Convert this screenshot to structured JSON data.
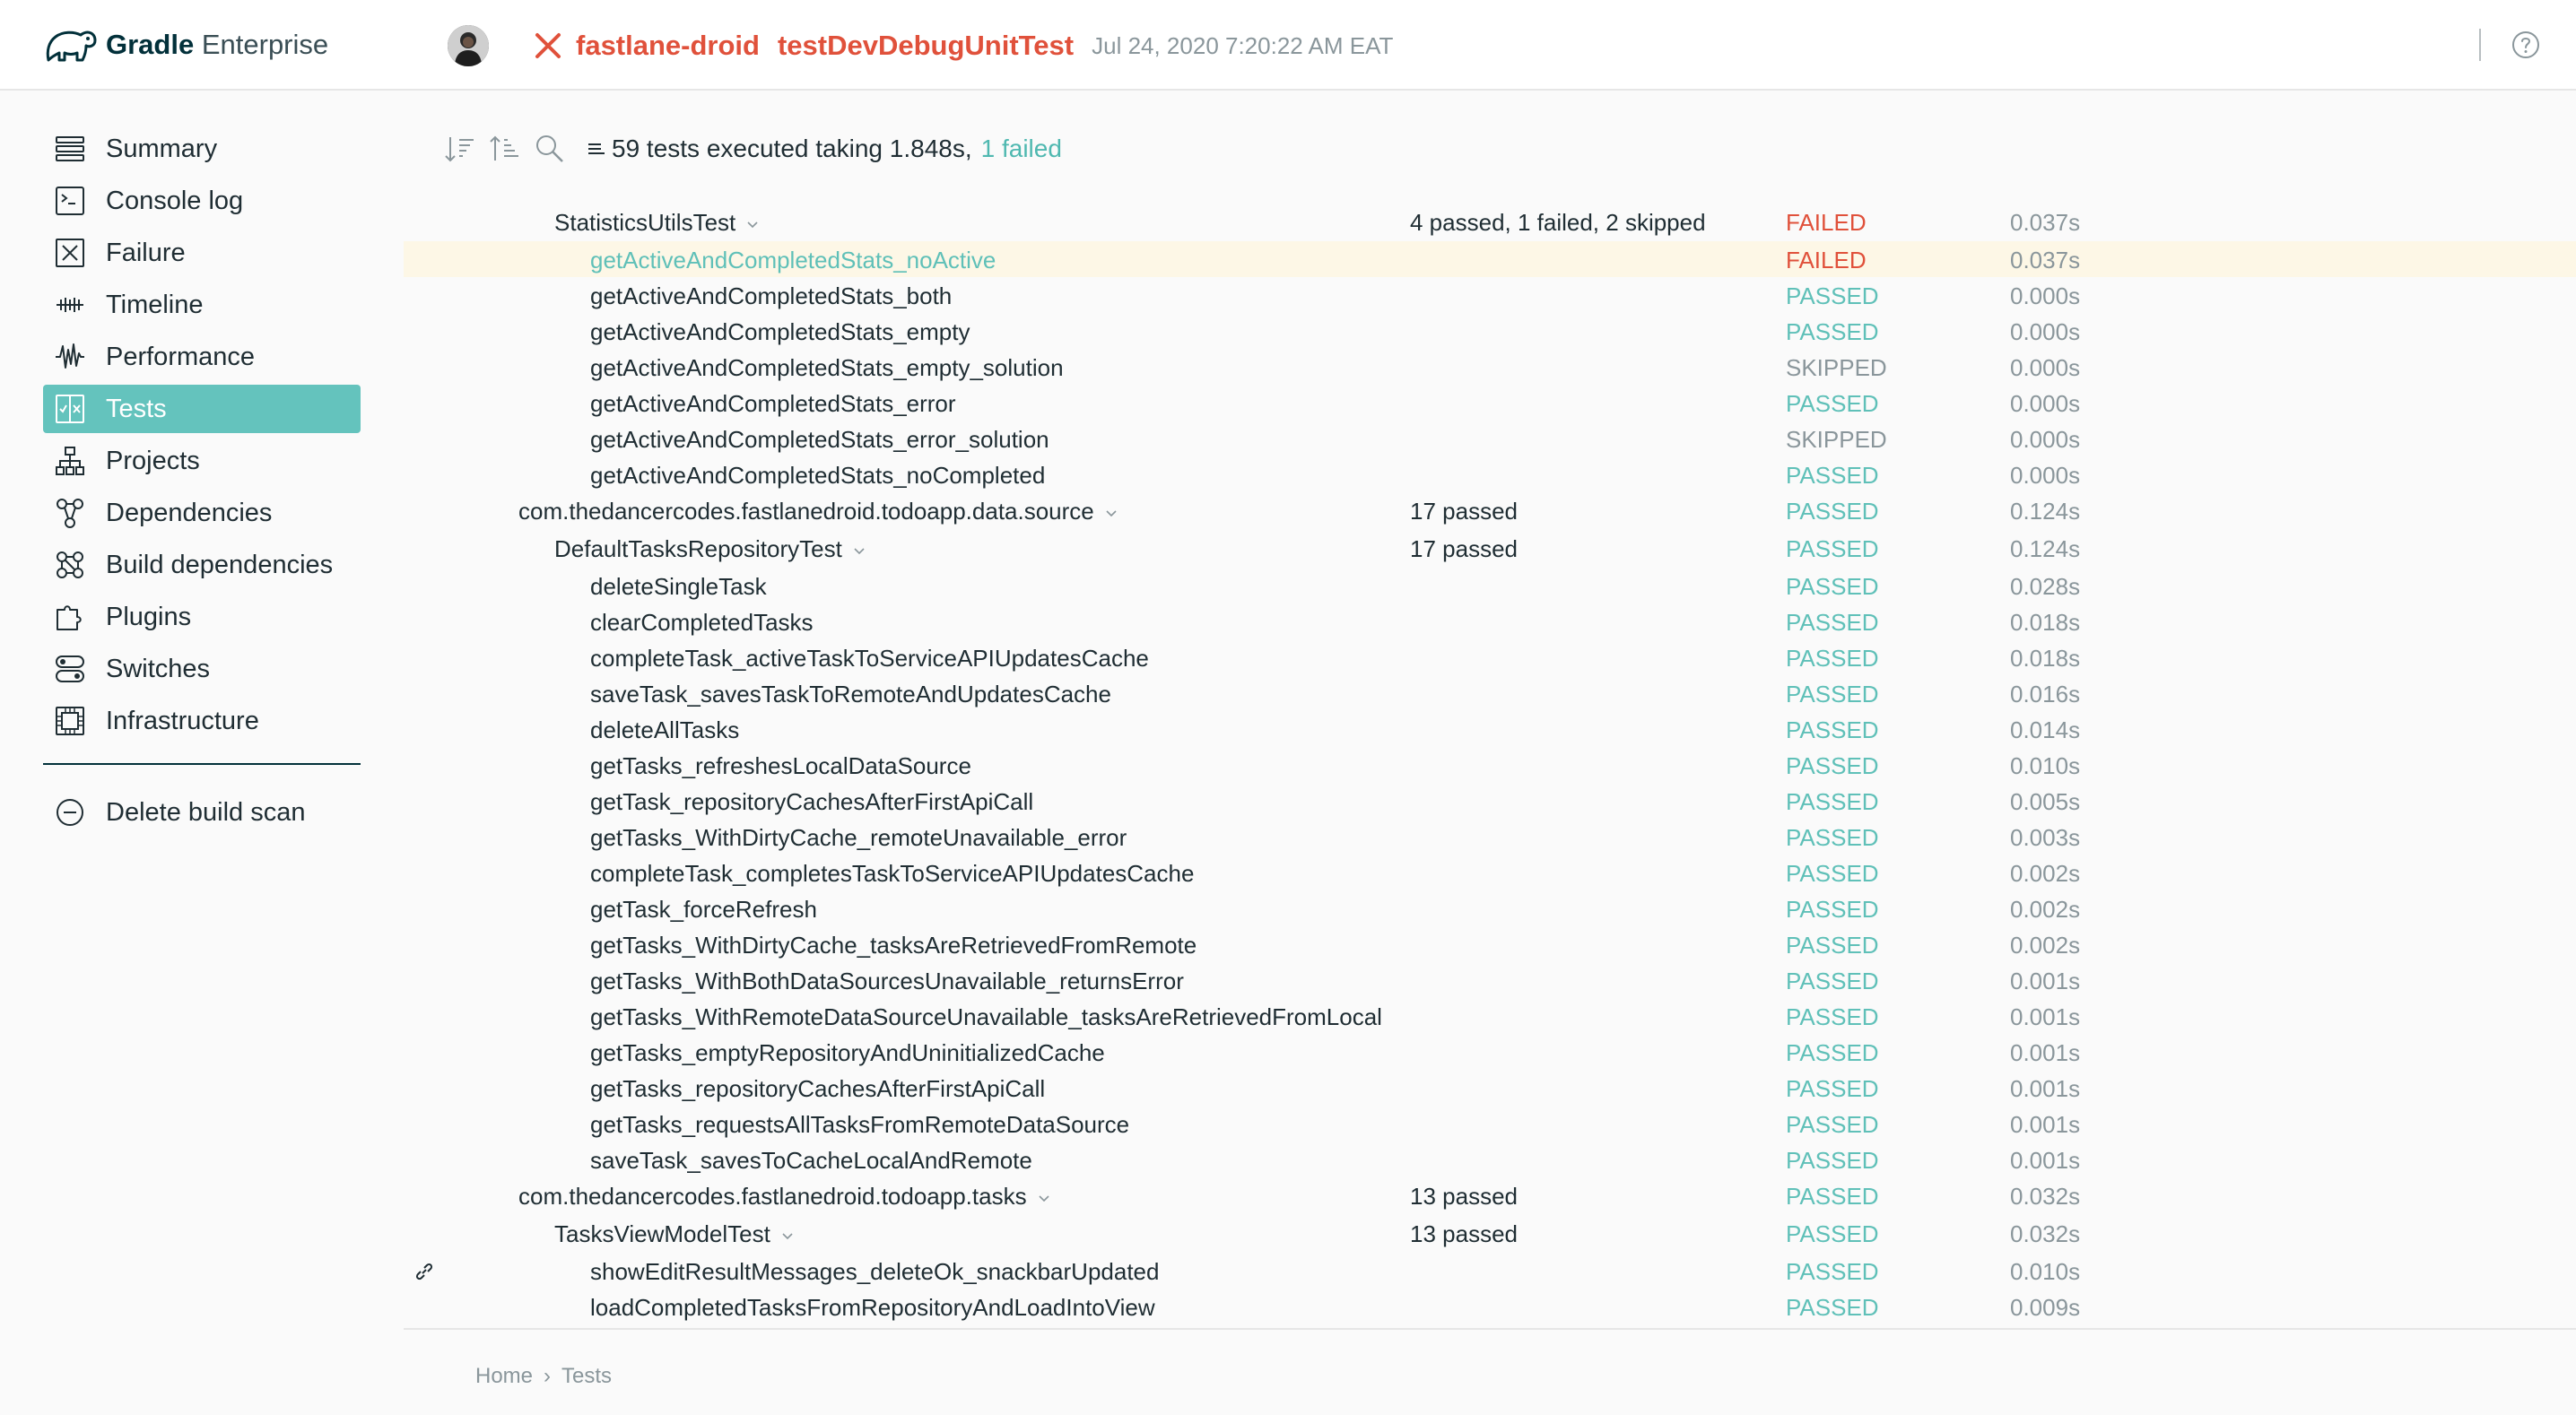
{
  "header": {
    "brand": "Gradle",
    "product": "Enterprise",
    "project": "fastlane-droid",
    "task": "testDevDebugUnitTest",
    "timestamp": "Jul 24, 2020 7:20:22 AM EAT"
  },
  "colors": {
    "accent": "#64c3bd",
    "failed": "#e0513b",
    "passed": "#5fc0b8",
    "skipped": "#8a969b",
    "highlight_row": "#fdf7e6"
  },
  "sidebar": {
    "items": [
      {
        "label": "Summary",
        "icon": "summary-icon"
      },
      {
        "label": "Console log",
        "icon": "console-icon"
      },
      {
        "label": "Failure",
        "icon": "failure-icon"
      },
      {
        "label": "Timeline",
        "icon": "timeline-icon"
      },
      {
        "label": "Performance",
        "icon": "performance-icon"
      },
      {
        "label": "Tests",
        "icon": "tests-icon",
        "active": true
      },
      {
        "label": "Projects",
        "icon": "projects-icon"
      },
      {
        "label": "Dependencies",
        "icon": "dependencies-icon"
      },
      {
        "label": "Build dependencies",
        "icon": "build-dependencies-icon"
      },
      {
        "label": "Plugins",
        "icon": "plugins-icon"
      },
      {
        "label": "Switches",
        "icon": "switches-icon"
      },
      {
        "label": "Infrastructure",
        "icon": "infrastructure-icon"
      }
    ],
    "delete_label": "Delete build scan"
  },
  "toolbar": {
    "summary_text": "59 tests executed taking",
    "duration": "1.848s,",
    "failed_link": "1 failed"
  },
  "tests": [
    {
      "name": "StatisticsUtilsTest",
      "level": 1,
      "expandable": true,
      "counts": "4 passed, 1 failed, 2 skipped",
      "status": "FAILED",
      "duration": "0.037s"
    },
    {
      "name": "getActiveAndCompletedStats_noActive",
      "level": 2,
      "highlight": true,
      "counts": "",
      "status": "FAILED",
      "duration": "0.037s"
    },
    {
      "name": "getActiveAndCompletedStats_both",
      "level": 2,
      "counts": "",
      "status": "PASSED",
      "duration": "0.000s"
    },
    {
      "name": "getActiveAndCompletedStats_empty",
      "level": 2,
      "counts": "",
      "status": "PASSED",
      "duration": "0.000s"
    },
    {
      "name": "getActiveAndCompletedStats_empty_solution",
      "level": 2,
      "counts": "",
      "status": "SKIPPED",
      "duration": "0.000s"
    },
    {
      "name": "getActiveAndCompletedStats_error",
      "level": 2,
      "counts": "",
      "status": "PASSED",
      "duration": "0.000s"
    },
    {
      "name": "getActiveAndCompletedStats_error_solution",
      "level": 2,
      "counts": "",
      "status": "SKIPPED",
      "duration": "0.000s"
    },
    {
      "name": "getActiveAndCompletedStats_noCompleted",
      "level": 2,
      "counts": "",
      "status": "PASSED",
      "duration": "0.000s"
    },
    {
      "name": "com.thedancercodes.fastlanedroid.todoapp.data.source",
      "level": 0,
      "expandable": true,
      "counts": "17 passed",
      "status": "PASSED",
      "duration": "0.124s"
    },
    {
      "name": "DefaultTasksRepositoryTest",
      "level": 1,
      "expandable": true,
      "counts": "17 passed",
      "status": "PASSED",
      "duration": "0.124s"
    },
    {
      "name": "deleteSingleTask",
      "level": 2,
      "counts": "",
      "status": "PASSED",
      "duration": "0.028s"
    },
    {
      "name": "clearCompletedTasks",
      "level": 2,
      "counts": "",
      "status": "PASSED",
      "duration": "0.018s"
    },
    {
      "name": "completeTask_activeTaskToServiceAPIUpdatesCache",
      "level": 2,
      "counts": "",
      "status": "PASSED",
      "duration": "0.018s"
    },
    {
      "name": "saveTask_savesTaskToRemoteAndUpdatesCache",
      "level": 2,
      "counts": "",
      "status": "PASSED",
      "duration": "0.016s"
    },
    {
      "name": "deleteAllTasks",
      "level": 2,
      "counts": "",
      "status": "PASSED",
      "duration": "0.014s"
    },
    {
      "name": "getTasks_refreshesLocalDataSource",
      "level": 2,
      "counts": "",
      "status": "PASSED",
      "duration": "0.010s"
    },
    {
      "name": "getTask_repositoryCachesAfterFirstApiCall",
      "level": 2,
      "counts": "",
      "status": "PASSED",
      "duration": "0.005s"
    },
    {
      "name": "getTasks_WithDirtyCache_remoteUnavailable_error",
      "level": 2,
      "counts": "",
      "status": "PASSED",
      "duration": "0.003s"
    },
    {
      "name": "completeTask_completesTaskToServiceAPIUpdatesCache",
      "level": 2,
      "counts": "",
      "status": "PASSED",
      "duration": "0.002s"
    },
    {
      "name": "getTask_forceRefresh",
      "level": 2,
      "counts": "",
      "status": "PASSED",
      "duration": "0.002s"
    },
    {
      "name": "getTasks_WithDirtyCache_tasksAreRetrievedFromRemote",
      "level": 2,
      "counts": "",
      "status": "PASSED",
      "duration": "0.002s"
    },
    {
      "name": "getTasks_WithBothDataSourcesUnavailable_returnsError",
      "level": 2,
      "counts": "",
      "status": "PASSED",
      "duration": "0.001s"
    },
    {
      "name": "getTasks_WithRemoteDataSourceUnavailable_tasksAreRetrievedFromLocal",
      "level": 2,
      "counts": "",
      "status": "PASSED",
      "duration": "0.001s"
    },
    {
      "name": "getTasks_emptyRepositoryAndUninitializedCache",
      "level": 2,
      "counts": "",
      "status": "PASSED",
      "duration": "0.001s"
    },
    {
      "name": "getTasks_repositoryCachesAfterFirstApiCall",
      "level": 2,
      "counts": "",
      "status": "PASSED",
      "duration": "0.001s"
    },
    {
      "name": "getTasks_requestsAllTasksFromRemoteDataSource",
      "level": 2,
      "counts": "",
      "status": "PASSED",
      "duration": "0.001s"
    },
    {
      "name": "saveTask_savesToCacheLocalAndRemote",
      "level": 2,
      "counts": "",
      "status": "PASSED",
      "duration": "0.001s"
    },
    {
      "name": "com.thedancercodes.fastlanedroid.todoapp.tasks",
      "level": 0,
      "expandable": true,
      "counts": "13 passed",
      "status": "PASSED",
      "duration": "0.032s"
    },
    {
      "name": "TasksViewModelTest",
      "level": 1,
      "expandable": true,
      "counts": "13 passed",
      "status": "PASSED",
      "duration": "0.032s"
    },
    {
      "name": "showEditResultMessages_deleteOk_snackbarUpdated",
      "level": 2,
      "link": true,
      "counts": "",
      "status": "PASSED",
      "duration": "0.010s"
    },
    {
      "name": "loadCompletedTasksFromRepositoryAndLoadIntoView",
      "level": 2,
      "counts": "",
      "status": "PASSED",
      "duration": "0.009s"
    }
  ],
  "breadcrumb": {
    "home": "Home",
    "sep": "›",
    "current": "Tests"
  }
}
